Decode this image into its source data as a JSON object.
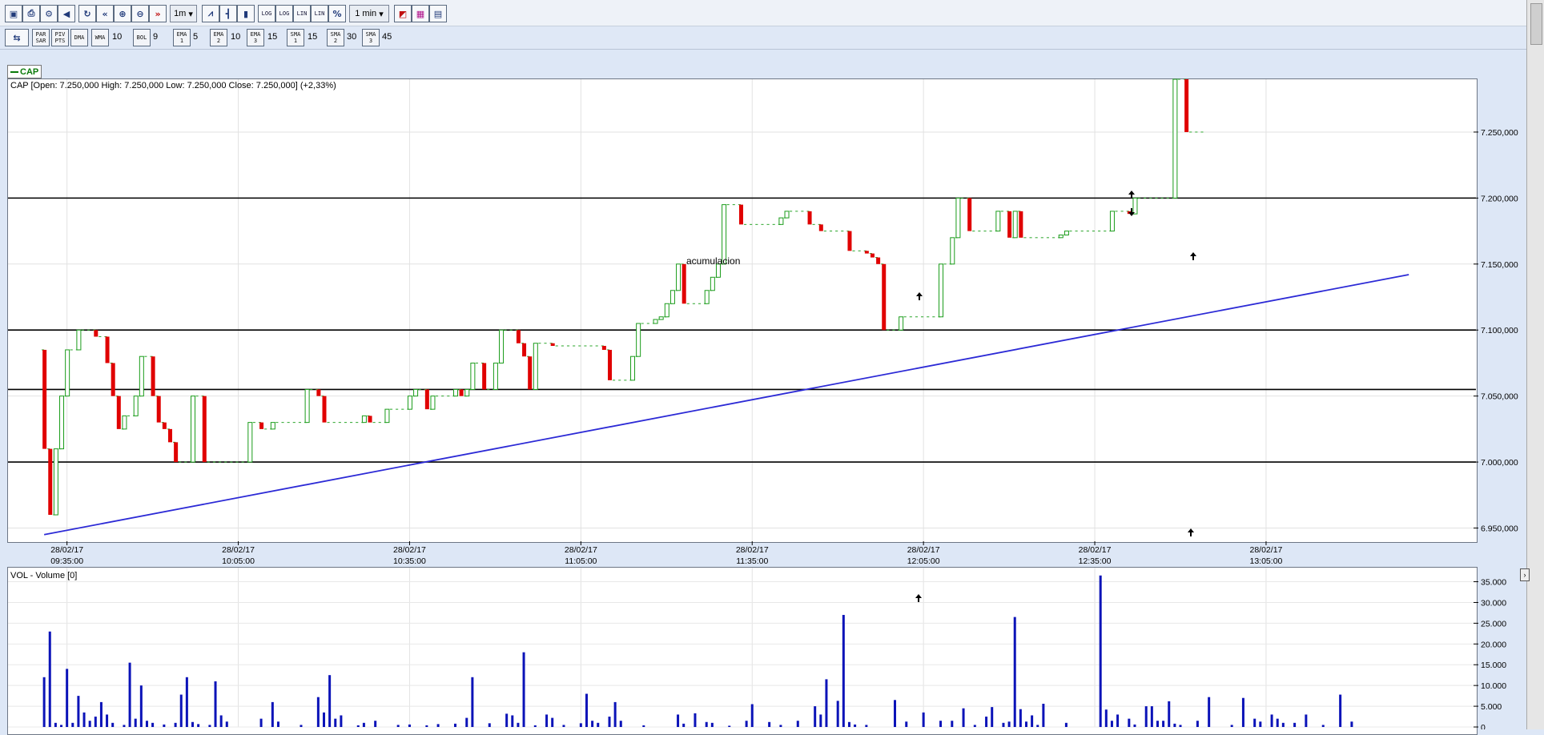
{
  "toolbar": {
    "period_value": "1m",
    "interval_value": "1 min",
    "log_labels": [
      "LOG",
      "LOG",
      "LIN",
      "LIN"
    ],
    "percent_label": "%"
  },
  "indicators": [
    {
      "label": "PAR SAR",
      "value": ""
    },
    {
      "label": "PIV PTS",
      "value": ""
    },
    {
      "label": "DMA",
      "value": ""
    },
    {
      "label": "WMA",
      "value": "10"
    },
    {
      "label": "BOL",
      "value": "9"
    },
    {
      "label": "EMA 1",
      "value": "5"
    },
    {
      "label": "EMA 2",
      "value": "10"
    },
    {
      "label": "EMA 3",
      "value": "15"
    },
    {
      "label": "SMA 1",
      "value": "15"
    },
    {
      "label": "SMA 2",
      "value": "30"
    },
    {
      "label": "SMA 3",
      "value": "45"
    }
  ],
  "symbol_tag": "CAP",
  "price_header": "CAP [Open: 7.250,000  High: 7.250,000  Low: 7.250,000  Close: 7.250,000] (+2,33%)",
  "volume_header": "VOL - Volume [0]",
  "annotation": "acumulacion",
  "chart_data": [
    {
      "type": "candlestick",
      "title": "CAP [Open: 7.250,000  High: 7.250,000  Low: 7.250,000  Close: 7.250,000] (+2,33%)",
      "ylim": [
        6.94,
        7.29
      ],
      "y_ticks": [
        6.95,
        7.0,
        7.05,
        7.1,
        7.15,
        7.2,
        7.25
      ],
      "y_tick_labels": [
        "6.950,000",
        "7.000,000",
        "7.050,000",
        "7.100,000",
        "7.150,000",
        "7.200,000",
        "7.250,000"
      ],
      "x_ticks": [
        {
          "minute": 35,
          "date": "28/02/17",
          "time": "09:35:00"
        },
        {
          "minute": 65,
          "date": "28/02/17",
          "time": "10:05:00"
        },
        {
          "minute": 95,
          "date": "28/02/17",
          "time": "10:35:00"
        },
        {
          "minute": 125,
          "date": "28/02/17",
          "time": "11:05:00"
        },
        {
          "minute": 155,
          "date": "28/02/17",
          "time": "11:35:00"
        },
        {
          "minute": 185,
          "date": "28/02/17",
          "time": "12:05:00"
        },
        {
          "minute": 215,
          "date": "28/02/17",
          "time": "12:35:00"
        },
        {
          "minute": 245,
          "date": "28/02/17",
          "time": "13:05:00"
        }
      ],
      "horizontal_lines": [
        7.2,
        7.1,
        7.055,
        7.0
      ],
      "trendline": [
        [
          31,
          6.945
        ],
        [
          270,
          7.142
        ]
      ],
      "close_prices": [
        7.085,
        7.01,
        6.96,
        7.01,
        7.05,
        7.085,
        7.085,
        7.1,
        7.1,
        7.1,
        7.095,
        7.095,
        7.075,
        7.05,
        7.025,
        7.035,
        7.035,
        7.05,
        7.08,
        7.08,
        7.05,
        7.03,
        7.025,
        7.015,
        7.0,
        7.0,
        7.0,
        7.05,
        7.05,
        7.0,
        7.0,
        7.0,
        7.0,
        7.0,
        7.0,
        7.0,
        7.0,
        7.03,
        7.03,
        7.025,
        7.025,
        7.03,
        7.03,
        7.03,
        7.03,
        7.03,
        7.03,
        7.055,
        7.055,
        7.05,
        7.03,
        7.03,
        7.03,
        7.03,
        7.03,
        7.03,
        7.03,
        7.035,
        7.03,
        7.03,
        7.03,
        7.04,
        7.04,
        7.04,
        7.04,
        7.05,
        7.055,
        7.055,
        7.04,
        7.05,
        7.05,
        7.05,
        7.05,
        7.055,
        7.05,
        7.055,
        7.075,
        7.075,
        7.055,
        7.055,
        7.075,
        7.1,
        7.1,
        7.1,
        7.09,
        7.08,
        7.055,
        7.09,
        7.09,
        7.09,
        7.088,
        7.088,
        7.088,
        7.088,
        7.088,
        7.088,
        7.088,
        7.088,
        7.088,
        7.085,
        7.062,
        7.062,
        7.062,
        7.062,
        7.08,
        7.105,
        7.105,
        7.105,
        7.108,
        7.11,
        7.12,
        7.13,
        7.15,
        7.12,
        7.12,
        7.12,
        7.12,
        7.13,
        7.14,
        7.15,
        7.195,
        7.195,
        7.195,
        7.18,
        7.18,
        7.18,
        7.18,
        7.18,
        7.18,
        7.18,
        7.185,
        7.19,
        7.19,
        7.19,
        7.19,
        7.18,
        7.18,
        7.175,
        7.175,
        7.175,
        7.175,
        7.175,
        7.16,
        7.16,
        7.16,
        7.158,
        7.155,
        7.15,
        7.1,
        7.1,
        7.1,
        7.11,
        7.11,
        7.11,
        7.11,
        7.11,
        7.11,
        7.11,
        7.15,
        7.15,
        7.17,
        7.2,
        7.2,
        7.175,
        7.175,
        7.175,
        7.175,
        7.175,
        7.19,
        7.19,
        7.17,
        7.19,
        7.17,
        7.17,
        7.17,
        7.17,
        7.17,
        7.17,
        7.17,
        7.172,
        7.175,
        7.175,
        7.175,
        7.175,
        7.175,
        7.175,
        7.175,
        7.175,
        7.19,
        7.19,
        7.19,
        7.188,
        7.2,
        7.2,
        7.2,
        7.2,
        7.2,
        7.2,
        7.2,
        7.29,
        7.29,
        7.25,
        7.25,
        7.25,
        7.25
      ]
    },
    {
      "type": "bar",
      "title": "VOL - Volume [0]",
      "ylim": [
        0,
        38000
      ],
      "y_ticks": [
        0,
        5000,
        10000,
        15000,
        20000,
        25000,
        30000,
        35000
      ],
      "y_tick_labels": [
        "0",
        "5.000",
        "10.000",
        "15.000",
        "20.000",
        "25.000",
        "30.000",
        "35.000"
      ],
      "volumes": [
        [
          31,
          12000
        ],
        [
          32,
          23000
        ],
        [
          33,
          1000
        ],
        [
          34,
          500
        ],
        [
          35,
          14000
        ],
        [
          36,
          1000
        ],
        [
          37,
          7500
        ],
        [
          38,
          3500
        ],
        [
          39,
          1500
        ],
        [
          40,
          2500
        ],
        [
          41,
          6000
        ],
        [
          42,
          3000
        ],
        [
          43,
          1000
        ],
        [
          45,
          500
        ],
        [
          46,
          15500
        ],
        [
          47,
          2000
        ],
        [
          48,
          10000
        ],
        [
          49,
          1500
        ],
        [
          50,
          1000
        ],
        [
          52,
          600
        ],
        [
          54,
          1000
        ],
        [
          55,
          7800
        ],
        [
          56,
          12000
        ],
        [
          57,
          1200
        ],
        [
          58,
          700
        ],
        [
          60,
          500
        ],
        [
          61,
          11000
        ],
        [
          62,
          2800
        ],
        [
          63,
          1300
        ],
        [
          69,
          2000
        ],
        [
          71,
          6000
        ],
        [
          72,
          1300
        ],
        [
          76,
          500
        ],
        [
          79,
          7200
        ],
        [
          80,
          3500
        ],
        [
          81,
          12500
        ],
        [
          82,
          2000
        ],
        [
          83,
          2800
        ],
        [
          86,
          400
        ],
        [
          87,
          1000
        ],
        [
          89,
          1500
        ],
        [
          93,
          500
        ],
        [
          95,
          600
        ],
        [
          98,
          400
        ],
        [
          100,
          700
        ],
        [
          103,
          800
        ],
        [
          105,
          2200
        ],
        [
          106,
          12000
        ],
        [
          109,
          900
        ],
        [
          112,
          3200
        ],
        [
          113,
          2800
        ],
        [
          114,
          1000
        ],
        [
          115,
          18000
        ],
        [
          117,
          400
        ],
        [
          119,
          3000
        ],
        [
          120,
          2200
        ],
        [
          122,
          500
        ],
        [
          125,
          900
        ],
        [
          126,
          8000
        ],
        [
          127,
          1500
        ],
        [
          128,
          1000
        ],
        [
          130,
          2500
        ],
        [
          131,
          6000
        ],
        [
          132,
          1500
        ],
        [
          136,
          400
        ],
        [
          142,
          3000
        ],
        [
          143,
          800
        ],
        [
          145,
          3300
        ],
        [
          147,
          1200
        ],
        [
          148,
          1000
        ],
        [
          151,
          300
        ],
        [
          154,
          1500
        ],
        [
          155,
          5500
        ],
        [
          158,
          1200
        ],
        [
          160,
          500
        ],
        [
          163,
          1500
        ],
        [
          166,
          5000
        ],
        [
          167,
          3000
        ],
        [
          168,
          11500
        ],
        [
          170,
          6300
        ],
        [
          171,
          27000
        ],
        [
          172,
          1200
        ],
        [
          173,
          600
        ],
        [
          175,
          500
        ],
        [
          180,
          6500
        ],
        [
          182,
          1300
        ],
        [
          185,
          3500
        ],
        [
          188,
          1500
        ],
        [
          190,
          1500
        ],
        [
          192,
          4500
        ],
        [
          194,
          500
        ],
        [
          196,
          2500
        ],
        [
          197,
          4800
        ],
        [
          199,
          1000
        ],
        [
          200,
          1300
        ],
        [
          201,
          26500
        ],
        [
          202,
          4300
        ],
        [
          203,
          1300
        ],
        [
          204,
          2800
        ],
        [
          205,
          500
        ],
        [
          206,
          5600
        ],
        [
          210,
          1000
        ],
        [
          216,
          36500
        ],
        [
          217,
          4200
        ],
        [
          218,
          1500
        ],
        [
          219,
          3000
        ],
        [
          221,
          2000
        ],
        [
          222,
          600
        ],
        [
          224,
          5000
        ],
        [
          225,
          5000
        ],
        [
          226,
          1500
        ],
        [
          227,
          1500
        ],
        [
          228,
          6200
        ],
        [
          229,
          800
        ],
        [
          230,
          500
        ],
        [
          233,
          1500
        ],
        [
          235,
          7200
        ],
        [
          239,
          500
        ],
        [
          241,
          7000
        ],
        [
          243,
          2000
        ],
        [
          244,
          1300
        ],
        [
          246,
          3000
        ],
        [
          247,
          2000
        ],
        [
          248,
          1000
        ],
        [
          250,
          1000
        ],
        [
          252,
          3000
        ],
        [
          255,
          500
        ],
        [
          258,
          7800
        ],
        [
          260,
          1300
        ]
      ]
    }
  ]
}
